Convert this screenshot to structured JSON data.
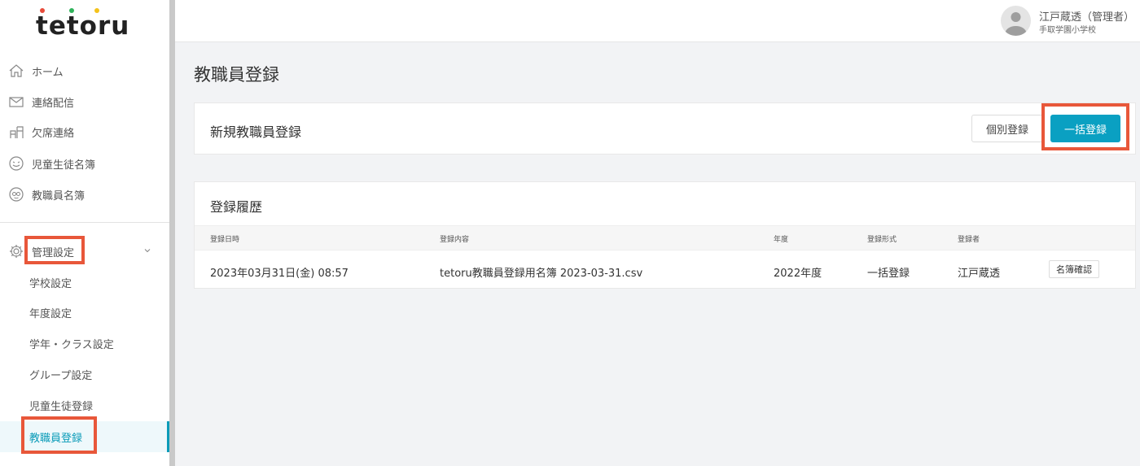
{
  "brand": {
    "logo_text": "tetoru",
    "dot_colors": [
      "#e84b3a",
      "#2fb35a",
      "#f4c21a"
    ]
  },
  "sidebar": {
    "main_items": [
      {
        "label": "ホーム",
        "icon": "home-icon"
      },
      {
        "label": "連絡配信",
        "icon": "mail-icon"
      },
      {
        "label": "欠席連絡",
        "icon": "desk-icon"
      },
      {
        "label": "児童生徒名簿",
        "icon": "child-face-icon"
      },
      {
        "label": "教職員名簿",
        "icon": "teacher-face-icon"
      }
    ],
    "settings_group": {
      "label": "管理設定",
      "icon": "gear-icon",
      "expand_icon": "chevron-down-icon"
    },
    "sub_items": [
      {
        "label": "学校設定"
      },
      {
        "label": "年度設定"
      },
      {
        "label": "学年・クラス設定"
      },
      {
        "label": "グループ設定"
      },
      {
        "label": "児童生徒登録"
      },
      {
        "label": "教職員登録"
      }
    ],
    "active_sub_item": "教職員登録"
  },
  "header": {
    "user_name": "江戸蔵透（管理者）",
    "school_name": "手取学園小学校"
  },
  "main": {
    "page_title": "教職員登録",
    "new_registration": {
      "title": "新規教職員登録",
      "individual_button": "個別登録",
      "bulk_button": "一括登録"
    },
    "history": {
      "title": "登録履歴",
      "columns": [
        "登録日時",
        "登録内容",
        "年度",
        "登録形式",
        "登録者"
      ],
      "rows": [
        {
          "datetime": "2023年03月31日(金) 08:57",
          "content": "tetoru教職員登録用名簿 2023-03-31.csv",
          "year": "2022年度",
          "format": "一括登録",
          "registrant": "江戸蔵透",
          "action": "名簿確認"
        }
      ]
    }
  },
  "colors": {
    "accent": "#0aa0c2",
    "highlight": "#e8573a"
  }
}
